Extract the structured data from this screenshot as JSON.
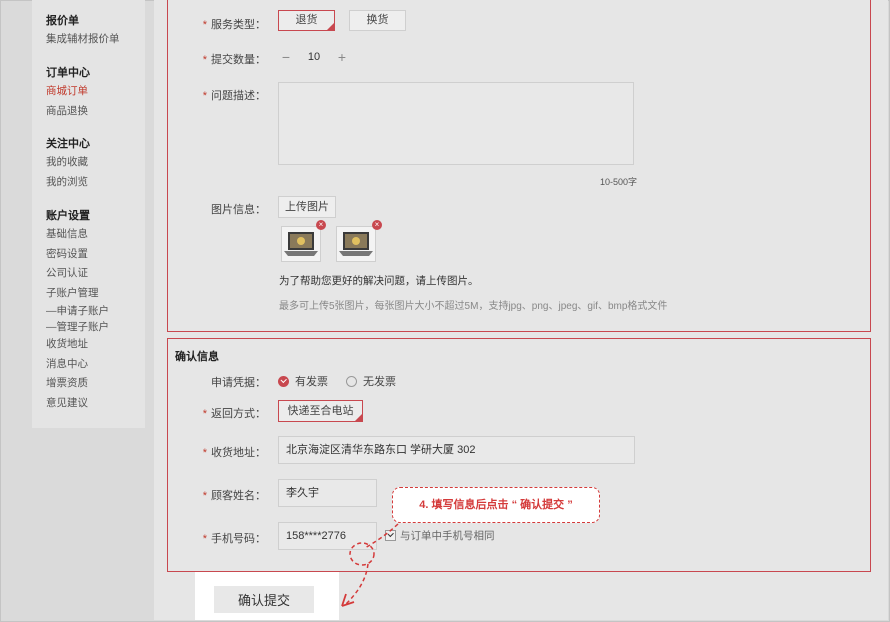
{
  "sidebar": {
    "groups": [
      {
        "title": "报价单",
        "items": [
          "集成辅材报价单"
        ]
      },
      {
        "title": "订单中心",
        "items": [
          "商城订单",
          "商品退换"
        ]
      },
      {
        "title": "关注中心",
        "items": [
          "我的收藏",
          "我的浏览"
        ]
      },
      {
        "title": "账户设置",
        "items": [
          "基础信息",
          "密码设置",
          "公司认证",
          "子账户管理",
          "—申请子账户",
          "—管理子账户",
          "收货地址",
          "消息中心",
          "增票资质",
          "意见建议"
        ]
      }
    ],
    "active_item": "商城订单"
  },
  "service": {
    "label": "服务类型：",
    "options": [
      "退货",
      "换货"
    ],
    "selected": "退货"
  },
  "quantity": {
    "label": "提交数量：",
    "minus": "−",
    "value": "10",
    "plus": "+"
  },
  "description": {
    "label": "问题描述：",
    "counter": "10-500字"
  },
  "images": {
    "label": "图片信息：",
    "upload_label": "上传图片",
    "delete_glyph": "×",
    "hint": "为了帮助您更好的解决问题，请上传图片。",
    "note": "最多可上传5张图片，每张图片大小不超过5M，支持jpg、png、jpeg、gif、bmp格式文件"
  },
  "confirm": {
    "title": "确认信息",
    "voucher_label": "申请凭据：",
    "voucher_options": [
      "有发票",
      "无发票"
    ],
    "voucher_selected": "有发票",
    "return_label": "返回方式：",
    "return_value": "快递至合电站",
    "address_label": "收货地址：",
    "address_value": "北京海淀区清华东路东口 学研大厦 302",
    "name_label": "顾客姓名：",
    "name_value": "李久宇",
    "phone_label": "手机号码：",
    "phone_value": "158****2776",
    "same_phone_label": "与订单中手机号相同"
  },
  "submit_label": "确认提交",
  "callout_text": "4. 填写信息后点击 “ 确认提交 ”",
  "colors": {
    "accent": "#c8484f",
    "callout": "#d43a3a"
  }
}
